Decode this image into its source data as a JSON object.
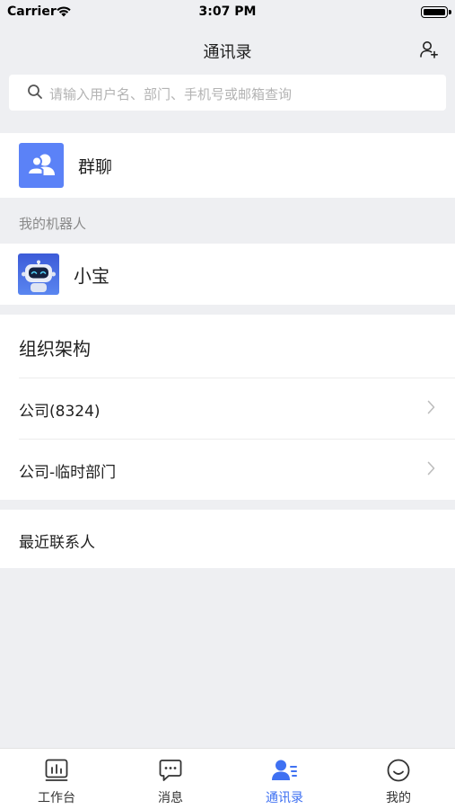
{
  "status_bar": {
    "carrier": "Carrier",
    "time": "3:07 PM"
  },
  "header": {
    "title": "通讯录"
  },
  "search": {
    "placeholder": "请输入用户名、部门、手机号或邮箱查询"
  },
  "group_chat": {
    "label": "群聊"
  },
  "my_robots": {
    "section_label": "我的机器人",
    "items": [
      {
        "label": "小宝"
      }
    ]
  },
  "org": {
    "title": "组织架构",
    "items": [
      {
        "label": "公司(8324)"
      },
      {
        "label": "公司-临时部门"
      }
    ]
  },
  "recent": {
    "label": "最近联系人"
  },
  "tabs": [
    {
      "label": "工作台",
      "icon": "workbench-icon",
      "active": false
    },
    {
      "label": "消息",
      "icon": "message-icon",
      "active": false
    },
    {
      "label": "通讯录",
      "icon": "contacts-icon",
      "active": true
    },
    {
      "label": "我的",
      "icon": "profile-icon",
      "active": false
    }
  ],
  "colors": {
    "accent": "#3f71f2",
    "group_icon_bg": "#5b82f7",
    "background": "#eeeff2"
  }
}
